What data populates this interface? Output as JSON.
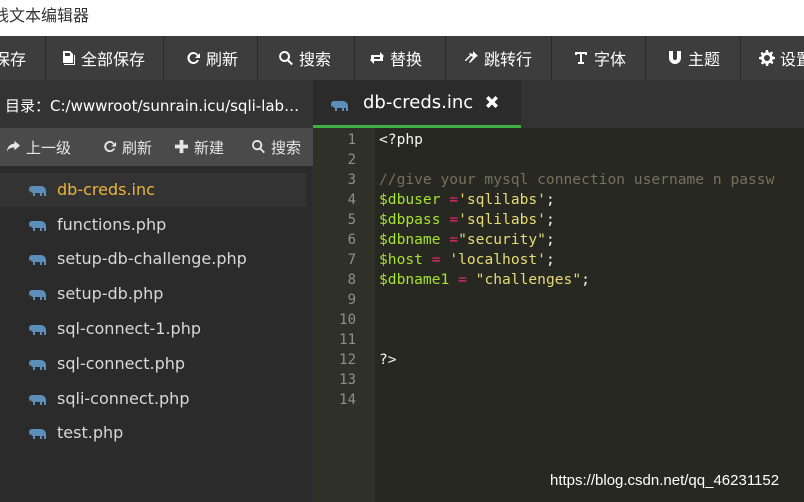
{
  "window": {
    "title": "线文本编辑器"
  },
  "toolbar": {
    "buttons": [
      {
        "label": "保存",
        "icon": "save-icon"
      },
      {
        "label": "全部保存",
        "icon": "save-all-icon"
      },
      {
        "label": "刷新",
        "icon": "refresh-icon"
      },
      {
        "label": "搜索",
        "icon": "search-icon"
      },
      {
        "label": "替换",
        "icon": "replace-icon"
      },
      {
        "label": "跳转行",
        "icon": "jump-icon"
      },
      {
        "label": "字体",
        "icon": "font-icon"
      },
      {
        "label": "主题",
        "icon": "theme-icon"
      },
      {
        "label": "设置",
        "icon": "gear-icon"
      }
    ]
  },
  "sidebar": {
    "directory": "目录：C:/wwwroot/sunrain.icu/sqli-labs...",
    "actions": [
      {
        "label": "上一级",
        "icon": "arrow-up-icon"
      },
      {
        "label": "刷新",
        "icon": "refresh-icon"
      },
      {
        "label": "新建",
        "icon": "plus-icon"
      },
      {
        "label": "搜索",
        "icon": "search-icon"
      }
    ],
    "files": [
      {
        "name": "db-creds.inc",
        "active": true
      },
      {
        "name": "functions.php"
      },
      {
        "name": "setup-db-challenge.php"
      },
      {
        "name": "setup-db.php"
      },
      {
        "name": "sql-connect-1.php"
      },
      {
        "name": "sql-connect.php"
      },
      {
        "name": "sqli-connect.php"
      },
      {
        "name": "test.php"
      }
    ]
  },
  "editor": {
    "tab": {
      "name": "db-creds.inc"
    },
    "line_numbers": [
      "1",
      "2",
      "3",
      "4",
      "5",
      "6",
      "7",
      "8",
      "9",
      "10",
      "11",
      "12",
      "13",
      "14"
    ],
    "lines": [
      {
        "open": "<?php"
      },
      {},
      {
        "comment": "//give your mysql connection username n passw"
      },
      {
        "var": "$dbuser",
        "gap": " ",
        "op": "=",
        "str": "'sqlilabs'",
        "end": ";"
      },
      {
        "var": "$dbpass",
        "gap": " ",
        "op": "=",
        "str": "'sqlilabs'",
        "end": ";"
      },
      {
        "var": "$dbname",
        "gap": " ",
        "op": "=",
        "str": "\"security\"",
        "end": ";"
      },
      {
        "var": "$host",
        "gap": " ",
        "op": "=",
        "str": " 'localhost'",
        "end": ";"
      },
      {
        "var": "$dbname1",
        "gap": " ",
        "op": "=",
        "str": " \"challenges\"",
        "end": ";"
      },
      {},
      {},
      {},
      {
        "close": "?>"
      },
      {},
      {}
    ]
  },
  "watermark": "https://blog.csdn.net/qq_46231152",
  "colors": {
    "accent": "#3fae45",
    "active_file": "#e9b63a",
    "variable": "#a6e22e",
    "operator": "#f92672",
    "string": "#e6db74",
    "comment": "#75715e"
  }
}
